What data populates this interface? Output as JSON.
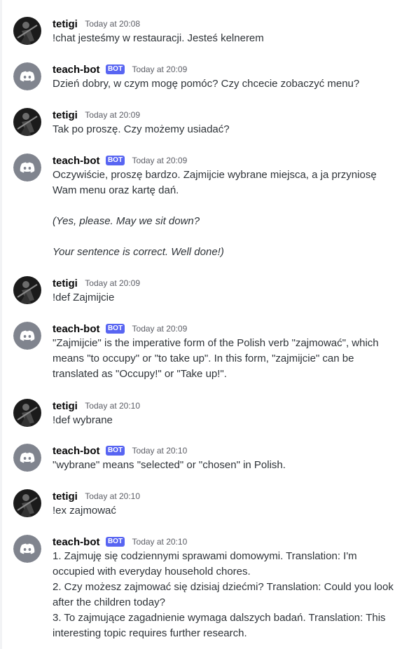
{
  "users": {
    "tetigi": {
      "name": "tetigi",
      "bot": false
    },
    "teachbot": {
      "name": "teach-bot",
      "bot": true,
      "tag": "BOT"
    }
  },
  "messages": [
    {
      "author": "tetigi",
      "time": "Today at 20:08",
      "lines": [
        "!chat jesteśmy w restauracji. Jesteś kelnerem"
      ]
    },
    {
      "author": "teach-bot",
      "time": "Today at 20:09",
      "lines": [
        "Dzień dobry, w czym mogę pomóc? Czy chcecie zobaczyć menu?"
      ]
    },
    {
      "author": "tetigi",
      "time": "Today at 20:09",
      "lines": [
        "Tak po proszę. Czy możemy usiadać?"
      ]
    },
    {
      "author": "teach-bot",
      "time": "Today at 20:09",
      "lines": [
        "Oczywiście, proszę bardzo. Zajmijcie wybrane miejsca, a ja przyniosę Wam menu oraz kartę dań.",
        "",
        "(Yes, please. May we sit down?",
        "",
        "Your sentence is correct. Well done!)"
      ]
    },
    {
      "author": "tetigi",
      "time": "Today at 20:09",
      "lines": [
        "!def Zajmijcie"
      ]
    },
    {
      "author": "teach-bot",
      "time": "Today at 20:09",
      "lines": [
        "\"Zajmijcie\" is the imperative form of the Polish verb \"zajmować\", which means \"to occupy\" or \"to take up\". In this form, \"zajmijcie\" can be translated as \"Occupy!\" or \"Take up!\"."
      ]
    },
    {
      "author": "tetigi",
      "time": "Today at 20:10",
      "lines": [
        "!def wybrane"
      ]
    },
    {
      "author": "teach-bot",
      "time": "Today at 20:10",
      "lines": [
        "\"wybrane\" means \"selected\" or \"chosen\" in Polish."
      ]
    },
    {
      "author": "tetigi",
      "time": "Today at 20:10",
      "lines": [
        "!ex zajmować"
      ]
    },
    {
      "author": "teach-bot",
      "time": "Today at 20:10",
      "lines": [
        "1. Zajmuję się codziennymi sprawami domowymi. Translation: I'm occupied with everyday household chores.",
        "2. Czy możesz zajmować się dzisiaj dziećmi? Translation: Could you look after the children today?",
        "3. To zajmujące zagadnienie wymaga dalszych badań. Translation: This interesting topic requires further research."
      ]
    }
  ],
  "colors": {
    "bot_tag": "#5865f2",
    "bot_avatar": "#80848e",
    "username": "#060607",
    "text": "#2e3338",
    "timestamp": "#5c5e66"
  },
  "icons": {
    "bot_avatar": "discord-logo-icon",
    "user_avatar": "user-photo-avatar"
  }
}
